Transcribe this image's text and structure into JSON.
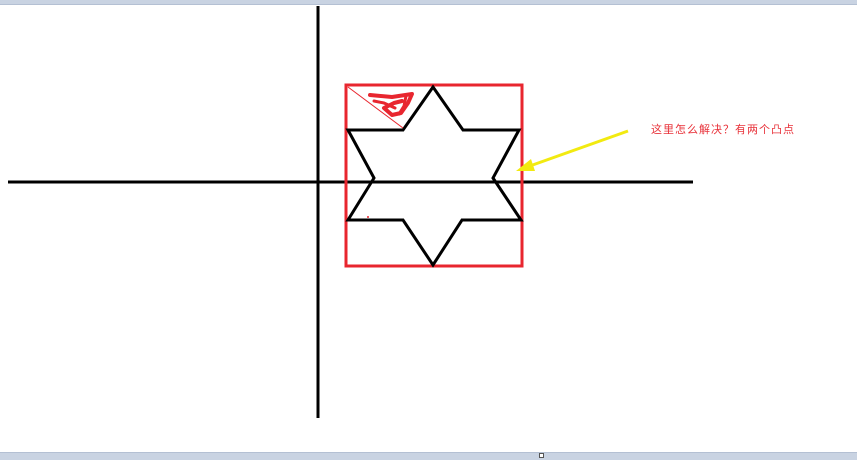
{
  "annotation": {
    "text": "这里怎么解决？有两个凸点",
    "color": "#e8323a"
  },
  "colors": {
    "axes": "#000000",
    "star": "#000000",
    "bounding_box": "#e8262f",
    "arrow": "#f2ea10",
    "scribble": "#e8262f",
    "frame": "#c9d3e2"
  },
  "icons": {
    "arrow": "arrow-left-icon",
    "scribble": "red-scribble-mark"
  }
}
